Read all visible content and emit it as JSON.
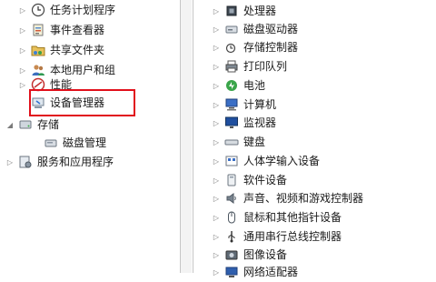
{
  "left_tree": [
    {
      "label": "任务计划程序",
      "icon": "clock-icon"
    },
    {
      "label": "事件查看器",
      "icon": "event-viewer-icon"
    },
    {
      "label": "共享文件夹",
      "icon": "shared-folder-icon"
    },
    {
      "label": "本地用户和组",
      "icon": "users-icon"
    },
    {
      "label": "性能",
      "icon": "performance-icon"
    },
    {
      "label": "设备管理器",
      "icon": "device-manager-icon"
    },
    {
      "label": "存储",
      "icon": "storage-icon"
    },
    {
      "label": "磁盘管理",
      "icon": "disk-management-icon"
    },
    {
      "label": "服务和应用程序",
      "icon": "services-icon"
    }
  ],
  "right_tree": [
    {
      "label": "处理器",
      "icon": "processor-icon"
    },
    {
      "label": "磁盘驱动器",
      "icon": "disk-drive-icon"
    },
    {
      "label": "存储控制器",
      "icon": "storage-controller-icon"
    },
    {
      "label": "打印队列",
      "icon": "printer-icon"
    },
    {
      "label": "电池",
      "icon": "battery-icon"
    },
    {
      "label": "计算机",
      "icon": "computer-icon"
    },
    {
      "label": "监视器",
      "icon": "monitor-icon"
    },
    {
      "label": "键盘",
      "icon": "keyboard-icon"
    },
    {
      "label": "人体学输入设备",
      "icon": "hid-icon"
    },
    {
      "label": "软件设备",
      "icon": "software-device-icon"
    },
    {
      "label": "声音、视频和游戏控制器",
      "icon": "sound-icon"
    },
    {
      "label": "鼠标和其他指针设备",
      "icon": "mouse-icon"
    },
    {
      "label": "通用串行总线控制器",
      "icon": "usb-icon"
    },
    {
      "label": "图像设备",
      "icon": "imaging-icon"
    },
    {
      "label": "网络适配器",
      "icon": "network-adapter-icon"
    }
  ],
  "colors": {
    "highlight_box": "#e1101b"
  }
}
